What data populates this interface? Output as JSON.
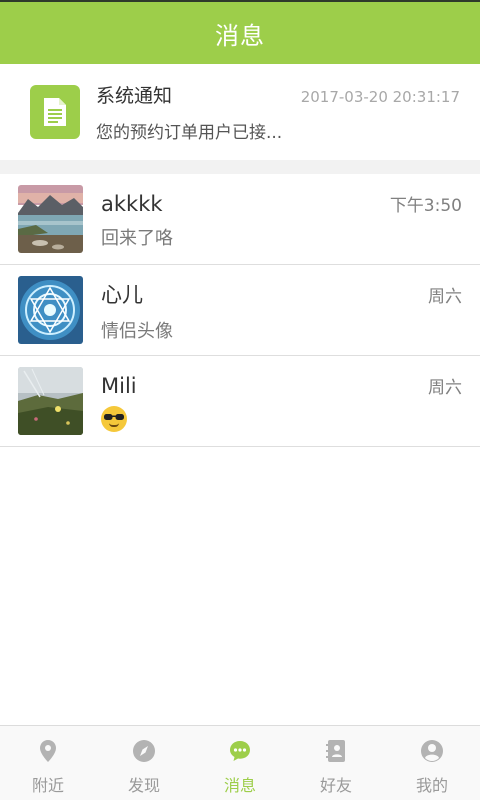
{
  "header": {
    "title": "消息"
  },
  "system_notice": {
    "title": "系统通知",
    "time": "2017-03-20 20:31:17",
    "preview": "您的预约订单用户已接..."
  },
  "chats": [
    {
      "name": "akkkk",
      "time": "下午3:50",
      "preview": "回来了咯",
      "avatar": "lake-landscape-avatar"
    },
    {
      "name": "心儿",
      "time": "周六",
      "preview": "情侣头像",
      "avatar": "magic-circle-avatar"
    },
    {
      "name": "Mili",
      "time": "周六",
      "preview": "",
      "preview_icon": "sunglasses-emoji",
      "avatar": "flower-field-avatar"
    }
  ],
  "tabs": [
    {
      "label": "附近",
      "icon": "location-pin-icon"
    },
    {
      "label": "发现",
      "icon": "compass-icon"
    },
    {
      "label": "消息",
      "icon": "chat-bubble-icon",
      "active": true
    },
    {
      "label": "好友",
      "icon": "contacts-icon"
    },
    {
      "label": "我的",
      "icon": "user-profile-icon"
    }
  ],
  "colors": {
    "accent": "#9dce4a",
    "inactive": "#9a9a9a"
  }
}
